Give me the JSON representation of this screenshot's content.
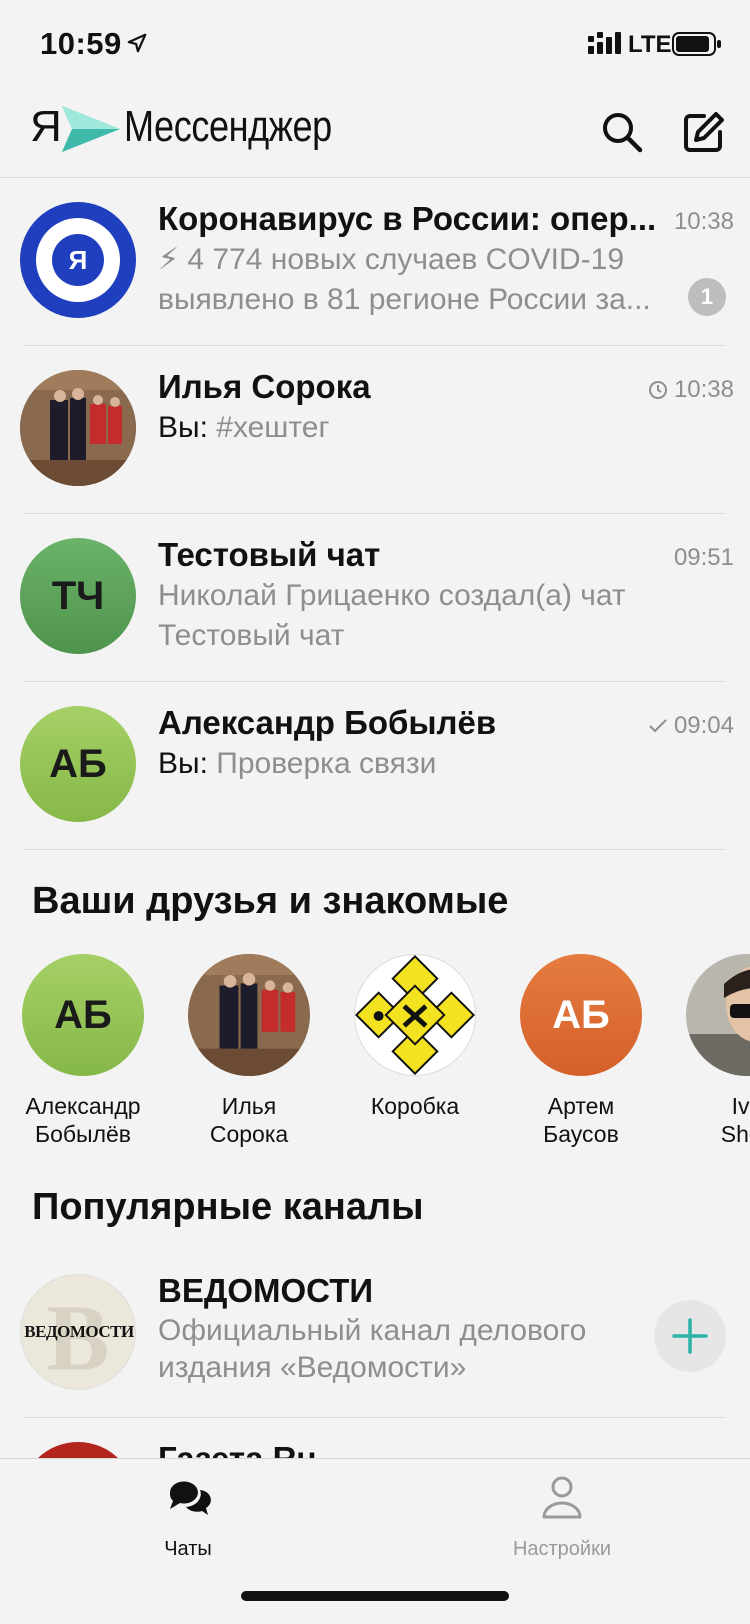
{
  "status_bar": {
    "time": "10:59",
    "network": "LTE"
  },
  "header": {
    "logo_ya": "Я",
    "logo_text": "Мессенджер"
  },
  "chats": [
    {
      "title": "Коронавирус в России: опер...",
      "time": "10:38",
      "preview_1": "⚡ 4 774 новых случаев COVID-19",
      "preview_2": "выявлено в 81 регионе России за...",
      "unread": "1",
      "avatar_letter": "Я"
    },
    {
      "title": "Илья Сорока",
      "time": "10:38",
      "you_prefix": "Вы:",
      "preview_1": "#хештег"
    },
    {
      "title": "Тестовый чат",
      "time": "09:51",
      "preview_1": "Николай Грицаенко создал(а) чат",
      "preview_2": "Тестовый чат",
      "initials": "ТЧ"
    },
    {
      "title": "Александр Бобылёв",
      "time": "09:04",
      "you_prefix": "Вы:",
      "preview_1": "Проверка связи",
      "initials": "АБ"
    }
  ],
  "friends_section": {
    "title": "Ваши друзья и знакомые",
    "items": [
      {
        "name_1": "Александр",
        "name_2": "Бобылёв",
        "initials": "АБ"
      },
      {
        "name_1": "Илья",
        "name_2": "Сорока"
      },
      {
        "name_1": "Коробка",
        "name_2": ""
      },
      {
        "name_1": "Артем",
        "name_2": "Баусов",
        "initials": "АБ"
      },
      {
        "name_1": "Iva",
        "name_2": "Shev"
      }
    ]
  },
  "channels_section": {
    "title": "Популярные каналы",
    "items": [
      {
        "title": "ВЕДОМОСТИ",
        "preview_1": "Официальный канал делового",
        "preview_2": "издания «Ведомости»",
        "logo_text": "ВЕДОМОСТИ"
      },
      {
        "title": "Газета.Ru"
      }
    ]
  },
  "tabs": [
    {
      "label": "Чаты",
      "active": true
    },
    {
      "label": "Настройки",
      "active": false
    }
  ],
  "colors": {
    "accent": "#2ab3a6",
    "bg": "#f3f3f3",
    "muted": "#8e8e8e"
  }
}
